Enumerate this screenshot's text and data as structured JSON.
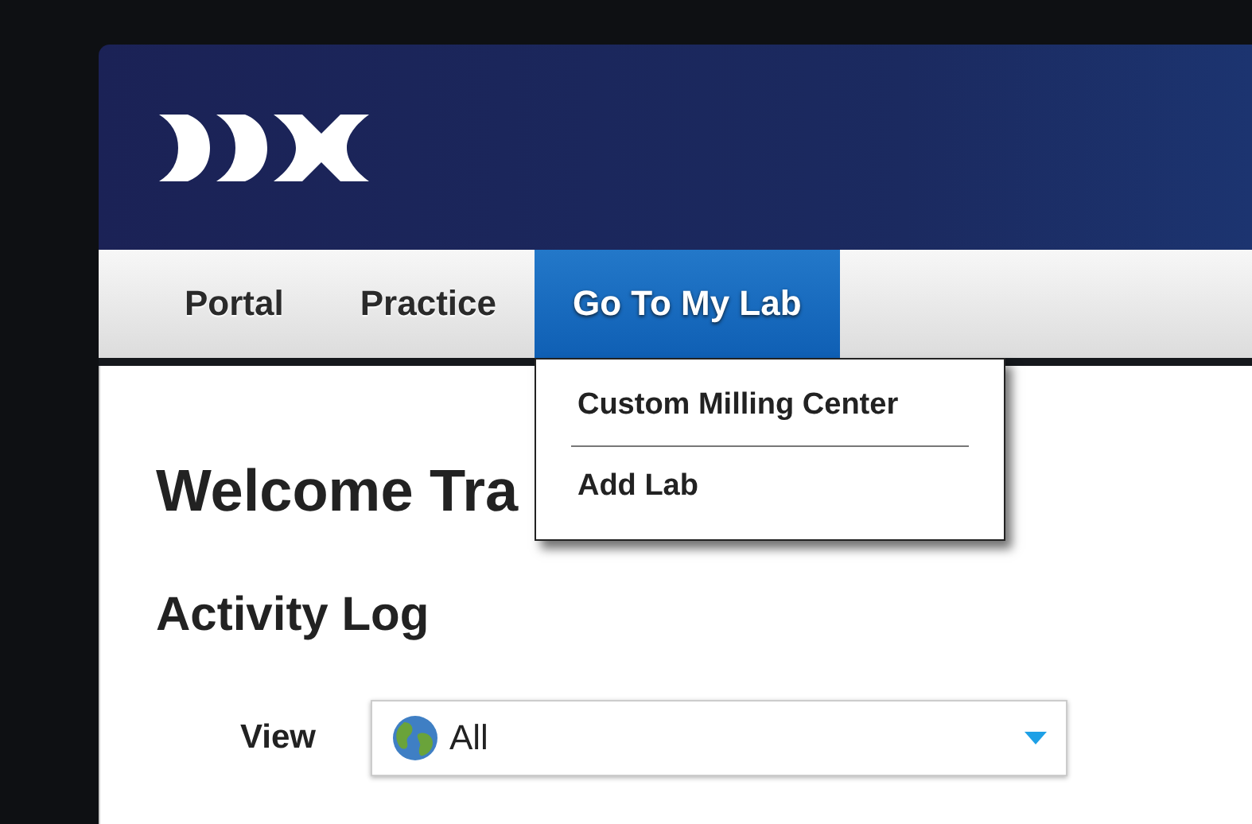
{
  "nav": {
    "tabs": [
      {
        "label": "Portal",
        "selected": false
      },
      {
        "label": "Practice",
        "selected": false
      },
      {
        "label": "Go To My Lab",
        "selected": true,
        "menu": {
          "items": [
            {
              "label": "Custom Milling Center"
            },
            {
              "label": "Add Lab"
            }
          ]
        }
      }
    ]
  },
  "content": {
    "title": "Welcome Tra",
    "section": "Activity Log",
    "view": {
      "label": "View",
      "value": "All"
    }
  }
}
